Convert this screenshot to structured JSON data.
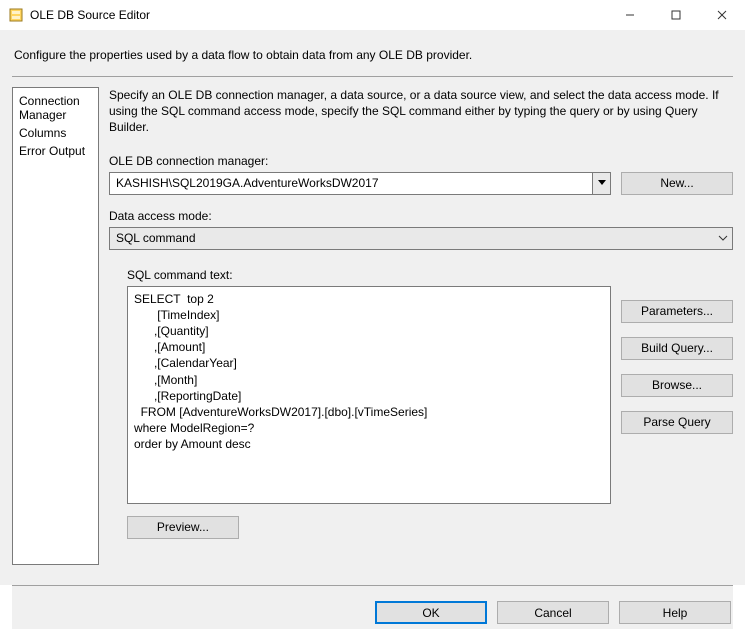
{
  "window": {
    "title": "OLE DB Source Editor",
    "minimize": "Minimize",
    "maximize": "Maximize",
    "close": "Close"
  },
  "intro": "Configure the properties used by a data flow to obtain data from any OLE DB provider.",
  "sidebar": {
    "items": [
      {
        "label": "Connection Manager"
      },
      {
        "label": "Columns"
      },
      {
        "label": "Error Output"
      }
    ]
  },
  "main": {
    "helptext": "Specify an OLE DB connection manager, a data source, or a data source view, and select the data access mode. If using the SQL command access mode, specify the SQL command either by typing the query or by using Query Builder.",
    "conn_label": "OLE DB connection manager:",
    "conn_value": "KASHISH\\SQL2019GA.AdventureWorksDW2017",
    "new_label": "New...",
    "mode_label": "Data access mode:",
    "mode_value": "SQL command",
    "sql_label": "SQL command text:",
    "sql_text": "SELECT  top 2\n       [TimeIndex]\n      ,[Quantity]\n      ,[Amount]\n      ,[CalendarYear]\n      ,[Month]\n      ,[ReportingDate]\n  FROM [AdventureWorksDW2017].[dbo].[vTimeSeries]\nwhere ModelRegion=?\norder by Amount desc",
    "buttons": {
      "parameters": "Parameters...",
      "build_query": "Build Query...",
      "browse": "Browse...",
      "parse_query": "Parse Query"
    },
    "preview_label": "Preview..."
  },
  "footer": {
    "ok": "OK",
    "cancel": "Cancel",
    "help": "Help"
  }
}
